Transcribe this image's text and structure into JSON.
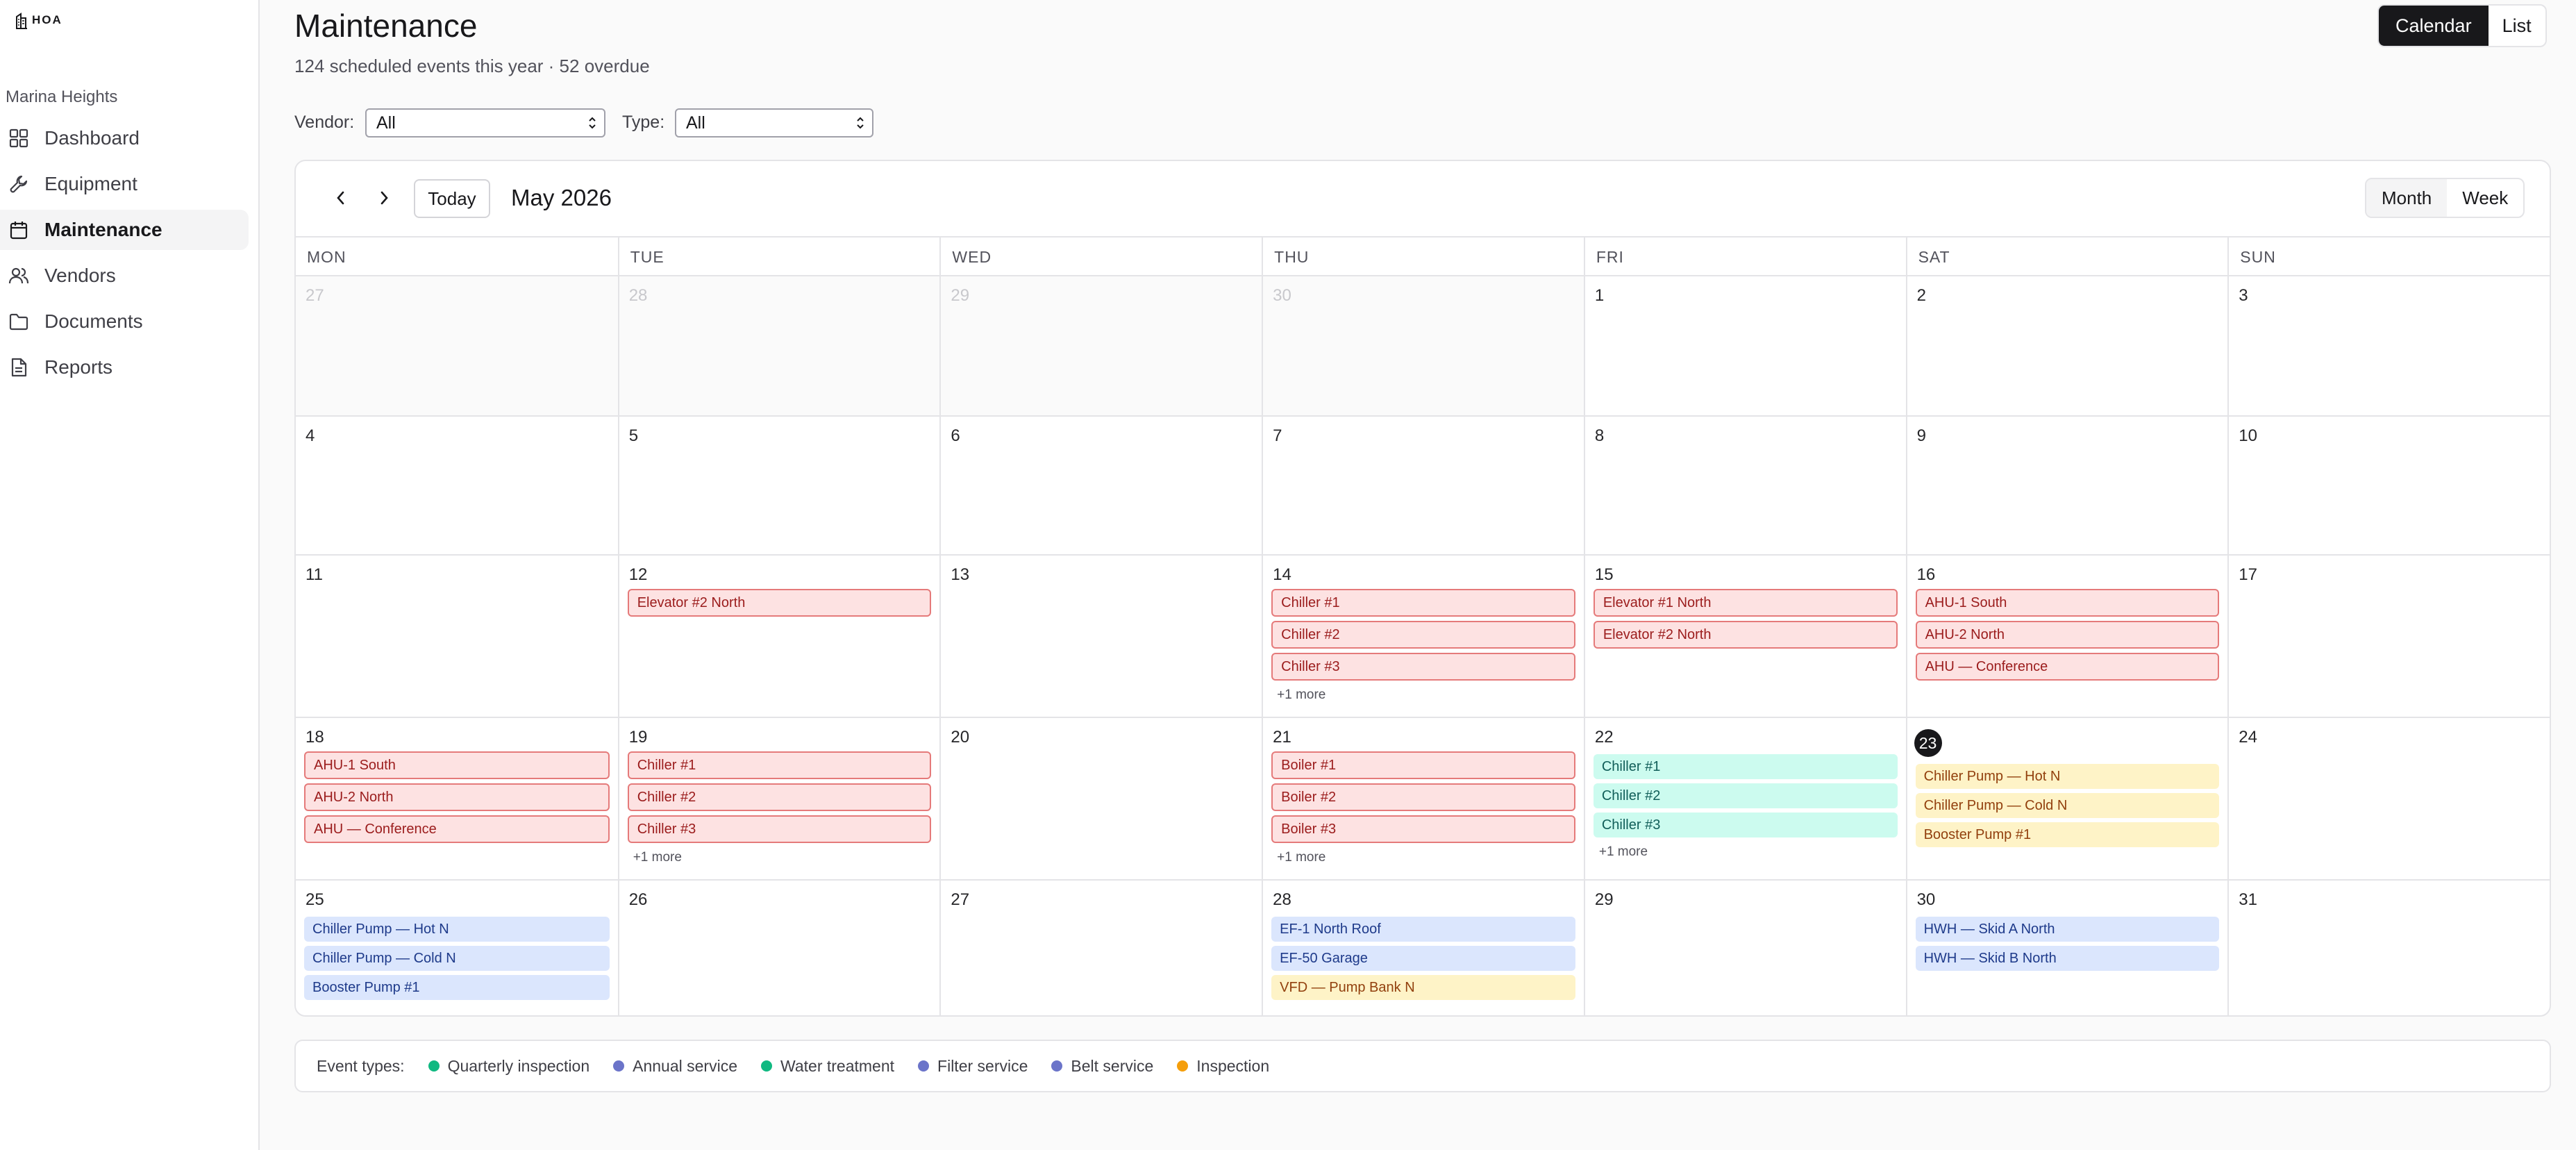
{
  "app": {
    "logo_text": "HOA"
  },
  "sidebar": {
    "org_name": "Marina Heights",
    "items": [
      {
        "label": "Dashboard",
        "icon": "dashboard-icon",
        "active": false
      },
      {
        "label": "Equipment",
        "icon": "wrench-icon",
        "active": false
      },
      {
        "label": "Maintenance",
        "icon": "calendar-icon",
        "active": true
      },
      {
        "label": "Vendors",
        "icon": "users-icon",
        "active": false
      },
      {
        "label": "Documents",
        "icon": "folder-icon",
        "active": false
      },
      {
        "label": "Reports",
        "icon": "report-icon",
        "active": false
      }
    ]
  },
  "header": {
    "title": "Maintenance",
    "subtitle": "124 scheduled events this year · 52 overdue",
    "view_options": [
      "Calendar",
      "List"
    ],
    "selected_view": "Calendar"
  },
  "filters": {
    "vendor_label": "Vendor:",
    "vendor_value": "All",
    "type_label": "Type:",
    "type_value": "All"
  },
  "calendar": {
    "today_label": "Today",
    "month_label": "May 2026",
    "mode_options": [
      "Month",
      "Week"
    ],
    "selected_mode": "Month",
    "days_of_week": [
      "MON",
      "TUE",
      "WED",
      "THU",
      "FRI",
      "SAT",
      "SUN"
    ],
    "today_day": "23",
    "weeks": [
      [
        {
          "day": "27",
          "outside": true,
          "events": []
        },
        {
          "day": "28",
          "outside": true,
          "events": []
        },
        {
          "day": "29",
          "outside": true,
          "events": []
        },
        {
          "day": "30",
          "outside": true,
          "events": []
        },
        {
          "day": "1",
          "events": []
        },
        {
          "day": "2",
          "events": []
        },
        {
          "day": "3",
          "events": []
        }
      ],
      [
        {
          "day": "4",
          "events": []
        },
        {
          "day": "5",
          "events": []
        },
        {
          "day": "6",
          "events": []
        },
        {
          "day": "7",
          "events": []
        },
        {
          "day": "8",
          "events": []
        },
        {
          "day": "9",
          "events": []
        },
        {
          "day": "10",
          "events": []
        }
      ],
      [
        {
          "day": "11",
          "events": []
        },
        {
          "day": "12",
          "events": [
            {
              "label": "Elevator #2 North",
              "status": "overdue"
            }
          ]
        },
        {
          "day": "13",
          "events": []
        },
        {
          "day": "14",
          "events": [
            {
              "label": "Chiller #1",
              "status": "overdue"
            },
            {
              "label": "Chiller #2",
              "status": "overdue"
            },
            {
              "label": "Chiller #3",
              "status": "overdue"
            }
          ],
          "more": "+1 more"
        },
        {
          "day": "15",
          "events": [
            {
              "label": "Elevator #1 North",
              "status": "overdue"
            },
            {
              "label": "Elevator #2 North",
              "status": "overdue"
            }
          ]
        },
        {
          "day": "16",
          "events": [
            {
              "label": "AHU-1 South",
              "status": "overdue"
            },
            {
              "label": "AHU-2 North",
              "status": "overdue"
            },
            {
              "label": "AHU — Conference",
              "status": "overdue"
            }
          ]
        },
        {
          "day": "17",
          "events": []
        }
      ],
      [
        {
          "day": "18",
          "events": [
            {
              "label": "AHU-1 South",
              "status": "overdue"
            },
            {
              "label": "AHU-2 North",
              "status": "overdue"
            },
            {
              "label": "AHU — Conference",
              "status": "overdue"
            }
          ]
        },
        {
          "day": "19",
          "events": [
            {
              "label": "Chiller #1",
              "status": "overdue"
            },
            {
              "label": "Chiller #2",
              "status": "overdue"
            },
            {
              "label": "Chiller #3",
              "status": "overdue"
            }
          ],
          "more": "+1 more"
        },
        {
          "day": "20",
          "events": []
        },
        {
          "day": "21",
          "events": [
            {
              "label": "Boiler #1",
              "status": "overdue"
            },
            {
              "label": "Boiler #2",
              "status": "overdue"
            },
            {
              "label": "Boiler #3",
              "status": "overdue"
            }
          ],
          "more": "+1 more"
        },
        {
          "day": "22",
          "events": [
            {
              "label": "Chiller #1",
              "status": "teal"
            },
            {
              "label": "Chiller #2",
              "status": "teal"
            },
            {
              "label": "Chiller #3",
              "status": "teal"
            }
          ],
          "more": "+1 more"
        },
        {
          "day": "23",
          "today": true,
          "events": [
            {
              "label": "Chiller Pump — Hot N",
              "status": "yellow"
            },
            {
              "label": "Chiller Pump — Cold N",
              "status": "yellow"
            },
            {
              "label": "Booster Pump #1",
              "status": "yellow"
            }
          ]
        },
        {
          "day": "24",
          "events": []
        }
      ],
      [
        {
          "day": "25",
          "events": [
            {
              "label": "Chiller Pump — Hot N",
              "status": "blue"
            },
            {
              "label": "Chiller Pump — Cold N",
              "status": "blue"
            },
            {
              "label": "Booster Pump #1",
              "status": "blue"
            }
          ]
        },
        {
          "day": "26",
          "events": []
        },
        {
          "day": "27",
          "events": []
        },
        {
          "day": "28",
          "events": [
            {
              "label": "EF-1 North Roof",
              "status": "blue"
            },
            {
              "label": "EF-50 Garage",
              "status": "blue"
            },
            {
              "label": "VFD — Pump Bank N",
              "status": "yellow"
            }
          ]
        },
        {
          "day": "29",
          "events": []
        },
        {
          "day": "30",
          "events": [
            {
              "label": "HWH — Skid A North",
              "status": "blue"
            },
            {
              "label": "HWH — Skid B North",
              "status": "blue"
            }
          ]
        },
        {
          "day": "31",
          "events": []
        }
      ]
    ]
  },
  "legend": {
    "title": "Event types:",
    "items": [
      {
        "label": "Quarterly inspection",
        "color": "#10b981"
      },
      {
        "label": "Annual service",
        "color": "#6b74c9"
      },
      {
        "label": "Water treatment",
        "color": "#10b981"
      },
      {
        "label": "Filter service",
        "color": "#6b74c9"
      },
      {
        "label": "Belt service",
        "color": "#6b74c9"
      },
      {
        "label": "Inspection",
        "color": "#f59e0b"
      }
    ]
  }
}
